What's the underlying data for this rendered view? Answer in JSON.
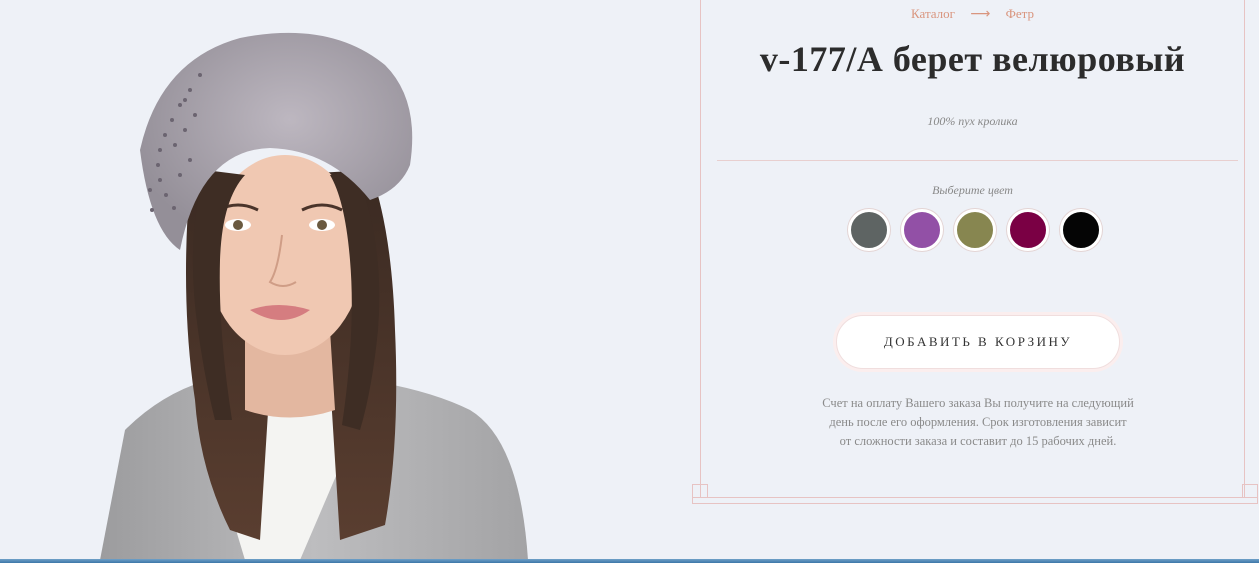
{
  "breadcrumb": {
    "items": [
      "Каталог",
      "Фетр"
    ],
    "separator": "⟶"
  },
  "product": {
    "title": "v-177/А берет велюровый",
    "material": "100% пух кролика"
  },
  "colors": {
    "label": "Выберите цвет",
    "swatches": [
      "#5e6463",
      "#9250a6",
      "#878650",
      "#7a0044",
      "#050505"
    ]
  },
  "cart": {
    "button_label": "ДОБАВИТЬ В КОРЗИНУ"
  },
  "note": {
    "lines": [
      "Счет на оплату Вашего заказа Вы получите на следующий",
      "день после его оформления. Срок изготовления зависит",
      "от сложности заказа и составит до 15 рабочих дней."
    ]
  },
  "accent": {
    "brand": "#d9957e",
    "border": "#e7c3c3"
  }
}
